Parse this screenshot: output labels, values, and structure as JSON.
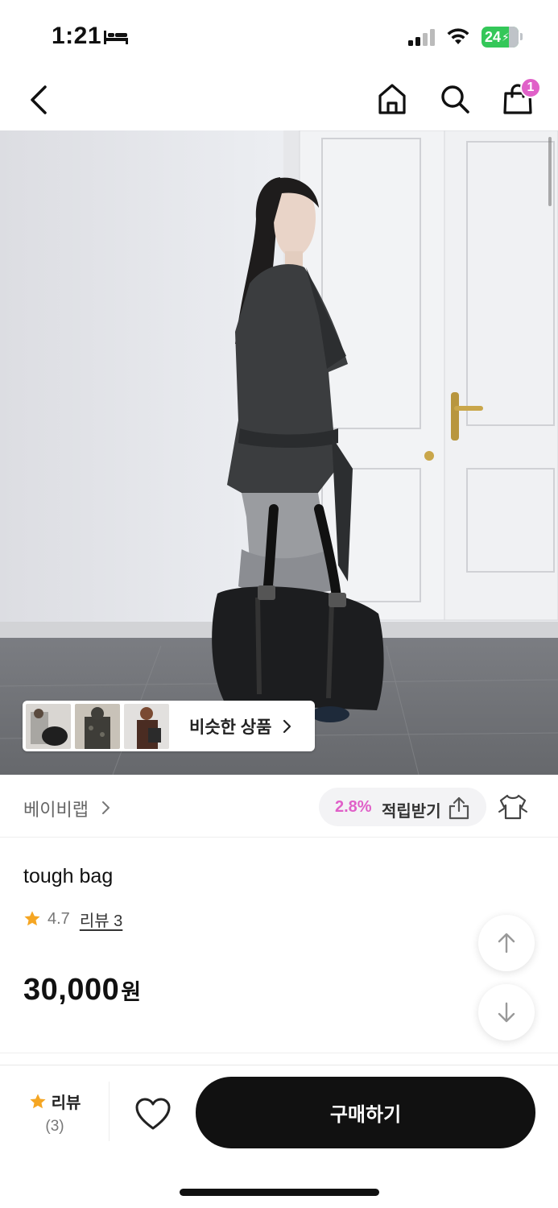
{
  "status_bar": {
    "time": "1:21",
    "battery": "24"
  },
  "nav": {
    "cart_count": "1"
  },
  "similar": {
    "label": "비슷한 상품"
  },
  "brand": {
    "name": "베이비랩"
  },
  "points": {
    "percent": "2.8%",
    "label": "적립받기"
  },
  "product": {
    "title": "tough bag",
    "rating": "4.7",
    "review_link": "리뷰 3",
    "price": "30,000",
    "currency": "원"
  },
  "bottom_bar": {
    "review_label": "리뷰",
    "review_count": "(3)",
    "buy_label": "구매하기"
  },
  "colors": {
    "accent": "#e060c8",
    "star": "#f5a623",
    "primary_button": "#111111"
  }
}
